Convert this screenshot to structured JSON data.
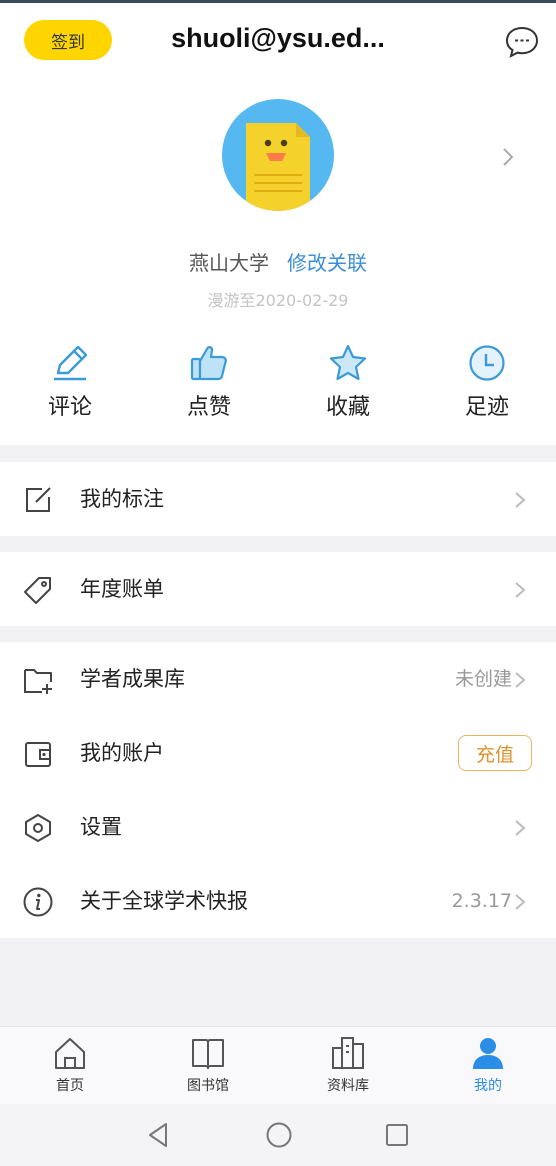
{
  "header": {
    "checkin_label": "签到",
    "title": "shuoli@ysu.ed..."
  },
  "profile": {
    "org_name": "燕山大学",
    "edit_link": "修改关联",
    "roam_text": "漫游至2020-02-29"
  },
  "quick_actions": [
    {
      "label": "评论",
      "icon": "pencil-icon"
    },
    {
      "label": "点赞",
      "icon": "thumbs-up-icon"
    },
    {
      "label": "收藏",
      "icon": "star-icon"
    },
    {
      "label": "足迹",
      "icon": "clock-icon"
    }
  ],
  "menu": {
    "annotations": {
      "label": "我的标注",
      "icon": "edit-square-icon"
    },
    "annual_bill": {
      "label": "年度账单",
      "icon": "tag-icon"
    },
    "scholar_library": {
      "label": "学者成果库",
      "value": "未创建",
      "icon": "folder-plus-icon"
    },
    "my_account": {
      "label": "我的账户",
      "action": "充值",
      "icon": "wallet-icon"
    },
    "settings": {
      "label": "设置",
      "icon": "hexagon-settings-icon"
    },
    "about": {
      "label": "关于全球学术快报",
      "value": "2.3.17",
      "icon": "info-icon"
    }
  },
  "tabs": [
    {
      "label": "首页",
      "icon": "home-icon"
    },
    {
      "label": "图书馆",
      "icon": "book-icon"
    },
    {
      "label": "资料库",
      "icon": "library-icon"
    },
    {
      "label": "我的",
      "icon": "user-icon",
      "active": true
    }
  ],
  "colors": {
    "accent": "#2b8ee6",
    "checkin_yellow": "#ffd500",
    "link_blue": "#3b8fd6",
    "recharge_orange": "#e0922a"
  }
}
